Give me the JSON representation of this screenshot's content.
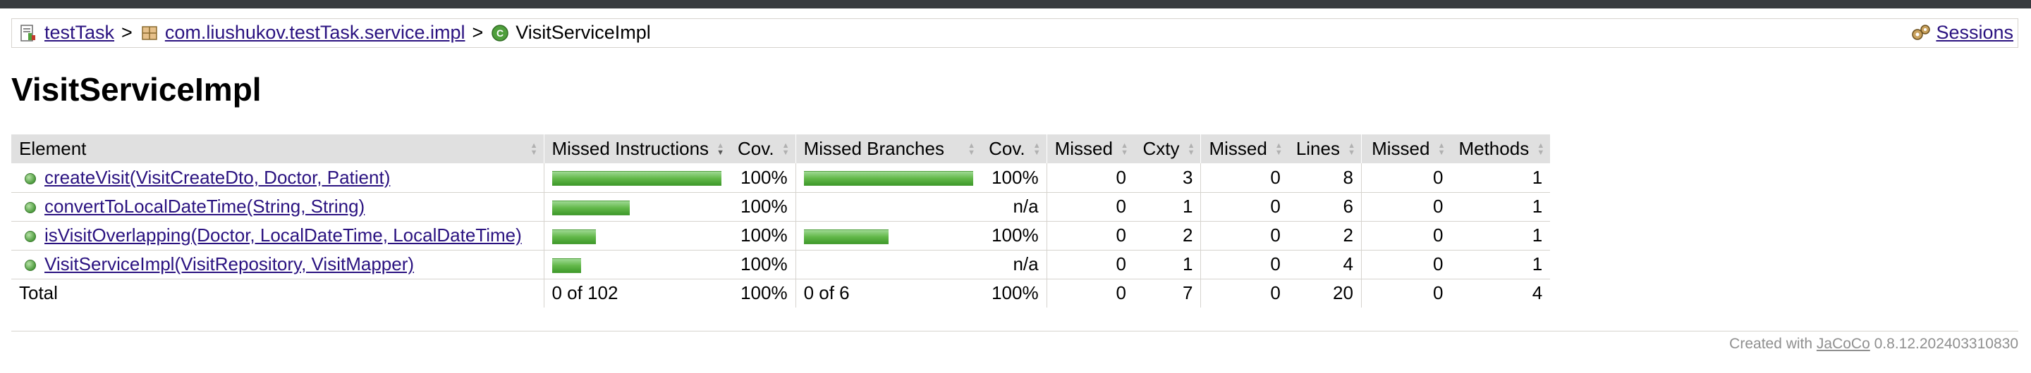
{
  "breadcrumb": {
    "project": "testTask",
    "separator": ">",
    "package": "com.liushukov.testTask.service.impl",
    "current": "VisitServiceImpl",
    "sessions": "Sessions"
  },
  "page_title": "VisitServiceImpl",
  "table": {
    "headers": [
      "Element",
      "Missed Instructions",
      "Cov.",
      "Missed Branches",
      "Cov.",
      "Missed",
      "Cxty",
      "Missed",
      "Lines",
      "Missed",
      "Methods"
    ],
    "rows": [
      {
        "element": "createVisit(VisitCreateDto, Doctor, Patient)",
        "instr_bar_fraction": 1.0,
        "instr_cov": "100%",
        "branch_bar_fraction": 1.0,
        "branch_cov": "100%",
        "missed_cxty": "0",
        "cxty": "3",
        "missed_lines": "0",
        "lines": "8",
        "missed_methods": "0",
        "methods": "1"
      },
      {
        "element": "convertToLocalDateTime(String, String)",
        "instr_bar_fraction": 0.46,
        "instr_cov": "100%",
        "branch_bar_fraction": 0,
        "branch_cov": "n/a",
        "missed_cxty": "0",
        "cxty": "1",
        "missed_lines": "0",
        "lines": "6",
        "missed_methods": "0",
        "methods": "1"
      },
      {
        "element": "isVisitOverlapping(Doctor, LocalDateTime, LocalDateTime)",
        "instr_bar_fraction": 0.26,
        "instr_cov": "100%",
        "branch_bar_fraction": 0.5,
        "branch_cov": "100%",
        "missed_cxty": "0",
        "cxty": "2",
        "missed_lines": "0",
        "lines": "2",
        "missed_methods": "0",
        "methods": "1"
      },
      {
        "element": "VisitServiceImpl(VisitRepository, VisitMapper)",
        "instr_bar_fraction": 0.17,
        "instr_cov": "100%",
        "branch_bar_fraction": 0,
        "branch_cov": "n/a",
        "missed_cxty": "0",
        "cxty": "1",
        "missed_lines": "0",
        "lines": "4",
        "missed_methods": "0",
        "methods": "1"
      }
    ],
    "total": {
      "label": "Total",
      "instr": "0 of 102",
      "instr_cov": "100%",
      "branch": "0 of 6",
      "branch_cov": "100%",
      "missed_cxty": "0",
      "cxty": "7",
      "missed_lines": "0",
      "lines": "20",
      "missed_methods": "0",
      "methods": "4"
    }
  },
  "footer": {
    "prefix": "Created with",
    "link": "JaCoCo",
    "version": "0.8.12.202403310830"
  },
  "colors": {
    "topbar": "#383b3f",
    "bar_green": "#63b84a",
    "link": "#2a1280",
    "header_bg": "#e0e0e0"
  }
}
